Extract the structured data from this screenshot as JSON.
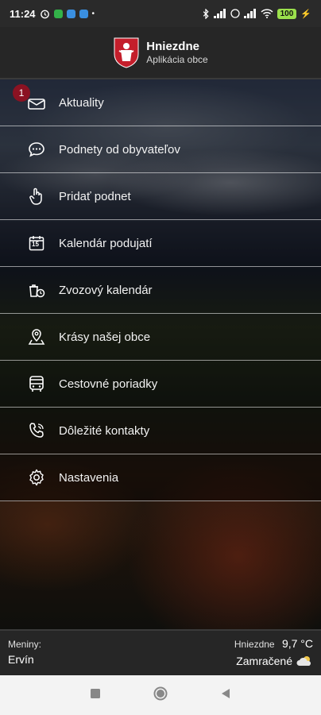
{
  "status_bar": {
    "time": "11:24",
    "battery": "100",
    "colors": {
      "accent_green": "#9be04c",
      "app_green": "#33b249",
      "app_blue": "#3a8fe0"
    }
  },
  "header": {
    "title": "Hniezdne",
    "subtitle": "Aplikácia obce",
    "crest_colors": {
      "red": "#c41e2b",
      "white": "#ffffff"
    }
  },
  "menu": {
    "items": [
      {
        "label": "Aktuality",
        "icon": "envelope-icon",
        "badge": "1"
      },
      {
        "label": "Podnety od obyvateľov",
        "icon": "chat-bubble-icon"
      },
      {
        "label": "Pridať podnet",
        "icon": "hand-pointer-icon"
      },
      {
        "label": "Kalendár podujatí",
        "icon": "calendar-icon",
        "calendar_day": "15"
      },
      {
        "label": "Zvozový kalendár",
        "icon": "recycle-bin-icon"
      },
      {
        "label": "Krásy našej obce",
        "icon": "location-pin-icon"
      },
      {
        "label": "Cestovné poriadky",
        "icon": "bus-icon"
      },
      {
        "label": "Dôležité kontakty",
        "icon": "phone-icon"
      },
      {
        "label": "Nastavenia",
        "icon": "gear-icon"
      }
    ],
    "badge_color": "#8b1222"
  },
  "footer": {
    "nameday_label": "Meniny:",
    "nameday_name": "Ervín",
    "weather_location": "Hniezdne",
    "weather_temp": "9,7 °C",
    "weather_desc": "Zamračené",
    "weather_icon": "cloud-icon"
  }
}
